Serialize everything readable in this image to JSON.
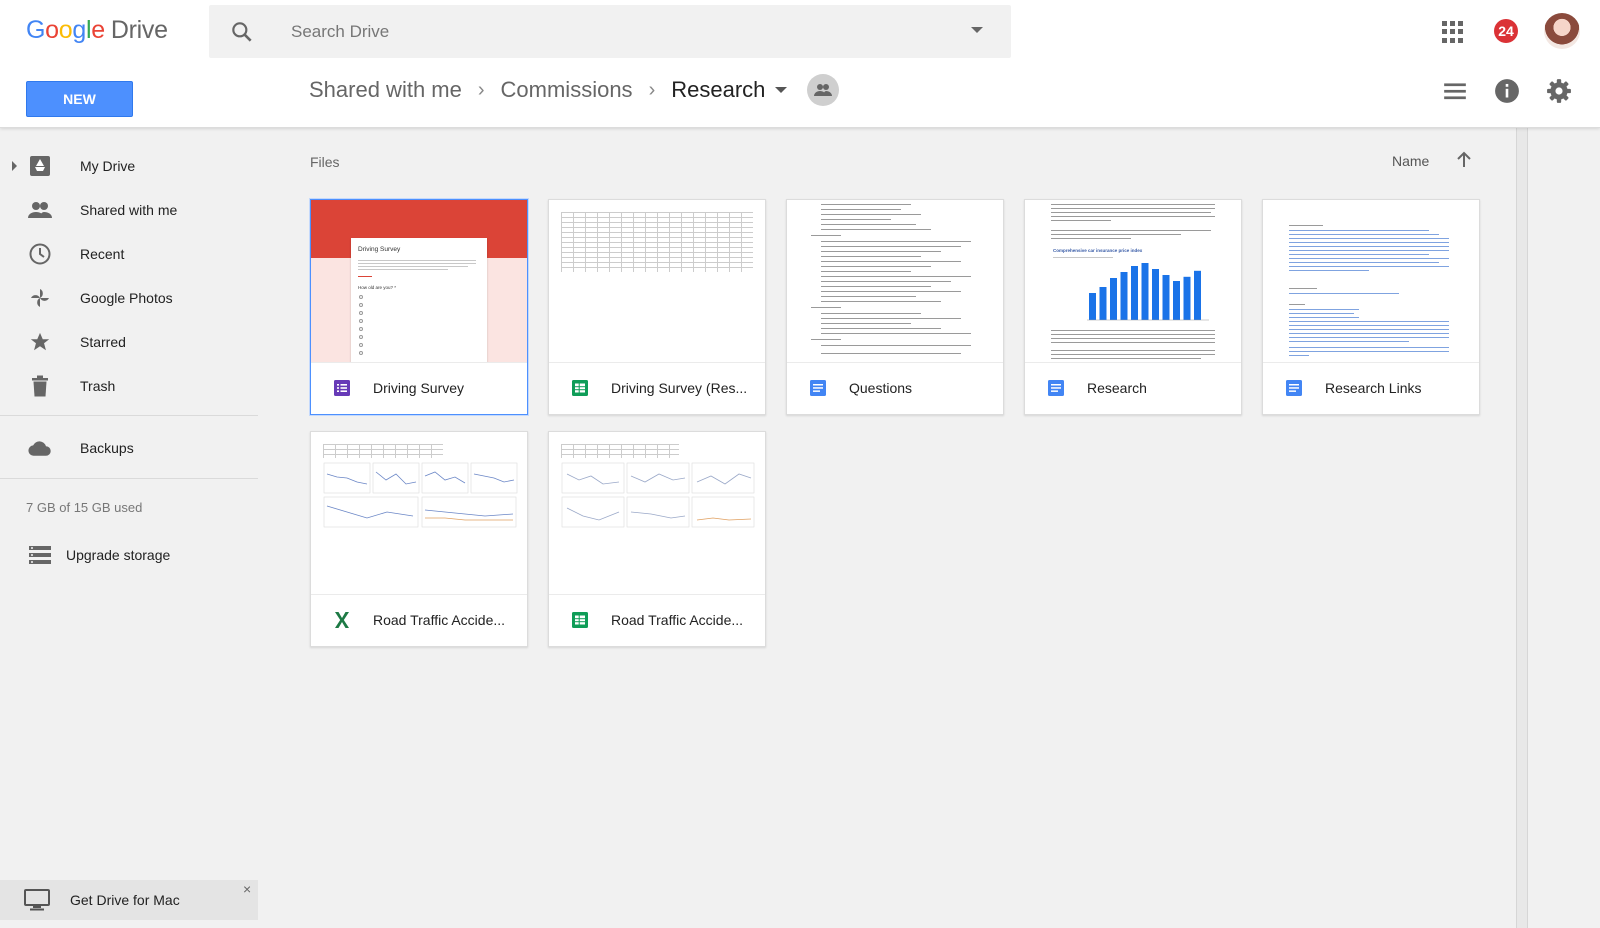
{
  "app": {
    "logo": {
      "letters": [
        "G",
        "o",
        "o",
        "g",
        "l",
        "e"
      ],
      "product": "Drive"
    },
    "search": {
      "placeholder": "Search Drive"
    },
    "notifications_count": "24",
    "new_button_label": "NEW"
  },
  "breadcrumb": {
    "items": [
      "Shared with me",
      "Commissions"
    ],
    "current": "Research"
  },
  "sidebar": {
    "items": [
      {
        "label": "My Drive",
        "icon": "my-drive-icon"
      },
      {
        "label": "Shared with me",
        "icon": "people-icon"
      },
      {
        "label": "Recent",
        "icon": "clock-icon"
      },
      {
        "label": "Google Photos",
        "icon": "pinwheel-icon"
      },
      {
        "label": "Starred",
        "icon": "star-icon"
      },
      {
        "label": "Trash",
        "icon": "trash-icon"
      },
      {
        "label": "Backups",
        "icon": "cloud-icon"
      }
    ],
    "storage_text": "7 GB of 15 GB used",
    "upgrade_label": "Upgrade storage",
    "get_drive_label": "Get Drive for Mac",
    "close_glyph": "×"
  },
  "main": {
    "section_label": "Files",
    "sort_label": "Name",
    "files": [
      {
        "name": "Driving Survey",
        "type": "form",
        "icon": "forms-icon",
        "selected": true
      },
      {
        "name": "Driving Survey (Res...",
        "type": "sheet",
        "icon": "sheets-icon",
        "selected": false
      },
      {
        "name": "Questions",
        "type": "doc",
        "icon": "docs-icon",
        "selected": false
      },
      {
        "name": "Research",
        "type": "doc",
        "icon": "docs-icon",
        "selected": false
      },
      {
        "name": "Research Links",
        "type": "doc",
        "icon": "docs-icon",
        "selected": false
      },
      {
        "name": "Road Traffic Accide...",
        "type": "excel",
        "icon": "excel-icon",
        "selected": false
      },
      {
        "name": "Road Traffic Accide...",
        "type": "sheet",
        "icon": "sheets-icon",
        "selected": false
      }
    ],
    "form_preview": {
      "title": "Driving Survey",
      "question": "How old are you? *"
    },
    "research_preview": {
      "chart_title": "Comprehensive car insurance price index",
      "bar_levels": [
        0.45,
        0.55,
        0.7,
        0.8,
        0.9,
        0.95,
        0.85,
        0.75,
        0.65,
        0.72,
        0.82
      ]
    }
  },
  "colors": {
    "new_button": "#4d90fe",
    "badge": "#db3236",
    "forms": "#673ab7",
    "sheets": "#0f9d58",
    "docs": "#4285f4",
    "excel": "#1d7a45",
    "form_header": "#db4437"
  }
}
